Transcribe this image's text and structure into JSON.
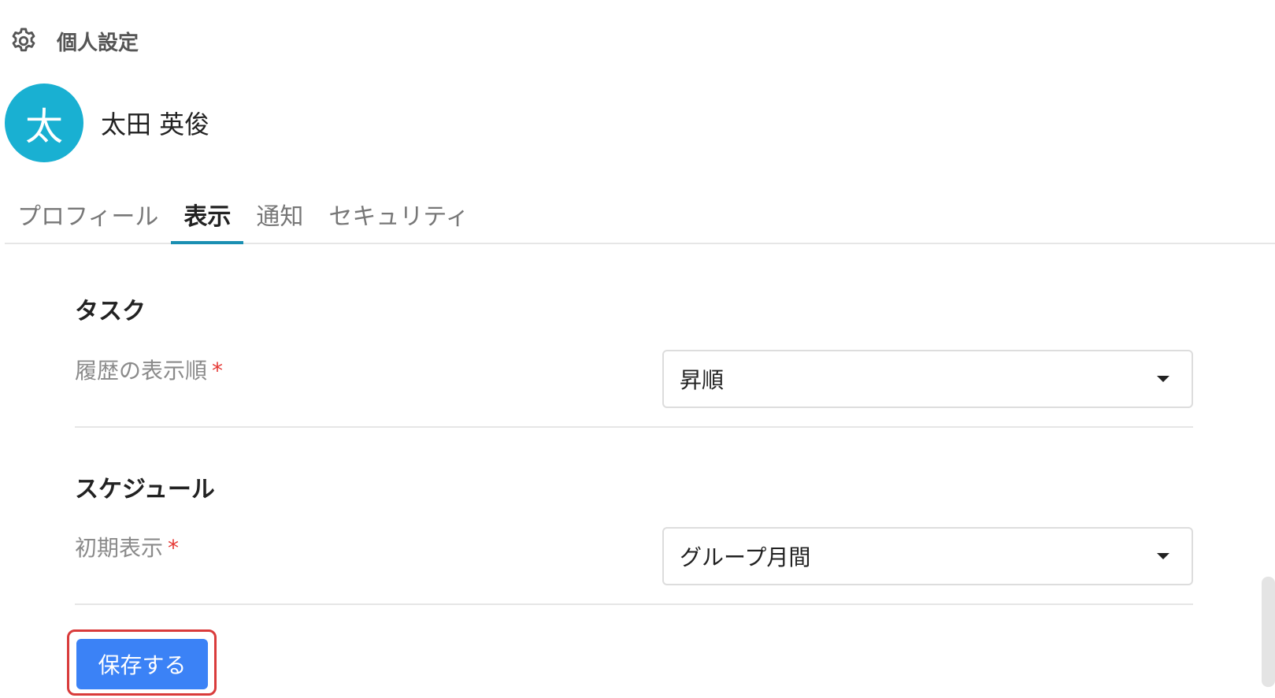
{
  "header": {
    "icon": "gear-icon",
    "title": "個人設定"
  },
  "user": {
    "avatar_initial": "太",
    "avatar_color": "#19b0d2",
    "name": "太田 英俊"
  },
  "tabs": [
    {
      "label": "プロフィール",
      "active": false
    },
    {
      "label": "表示",
      "active": true
    },
    {
      "label": "通知",
      "active": false
    },
    {
      "label": "セキュリティ",
      "active": false
    }
  ],
  "sections": {
    "task": {
      "title": "タスク",
      "field_label": "履歴の表示順",
      "required_mark": "*",
      "selected": "昇順"
    },
    "schedule": {
      "title": "スケジュール",
      "field_label": "初期表示",
      "required_mark": "*",
      "selected": "グループ月間"
    }
  },
  "actions": {
    "save_label": "保存する"
  },
  "colors": {
    "accent": "#1a8fb2",
    "primary_button": "#3b82f6",
    "highlight_outline": "#d93b3b",
    "required": "#e53935"
  }
}
